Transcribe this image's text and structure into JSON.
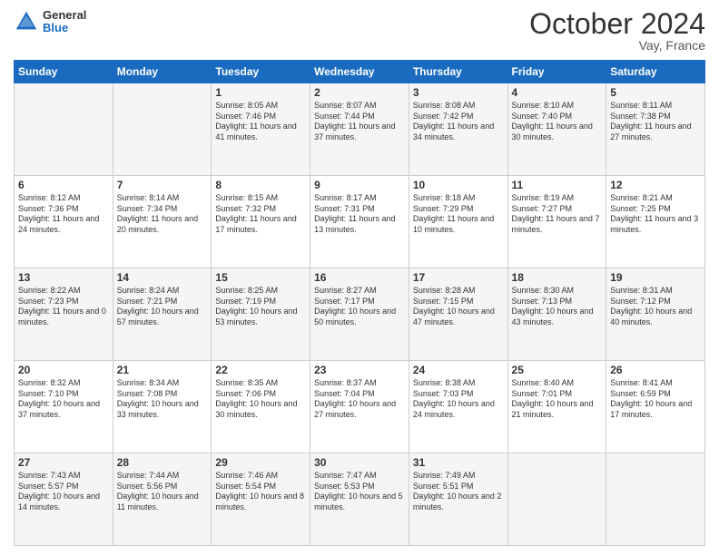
{
  "header": {
    "logo_general": "General",
    "logo_blue": "Blue",
    "month_title": "October 2024",
    "location": "Vay, France"
  },
  "weekdays": [
    "Sunday",
    "Monday",
    "Tuesday",
    "Wednesday",
    "Thursday",
    "Friday",
    "Saturday"
  ],
  "weeks": [
    [
      {
        "day": "",
        "sunrise": "",
        "sunset": "",
        "daylight": ""
      },
      {
        "day": "",
        "sunrise": "",
        "sunset": "",
        "daylight": ""
      },
      {
        "day": "1",
        "sunrise": "Sunrise: 8:05 AM",
        "sunset": "Sunset: 7:46 PM",
        "daylight": "Daylight: 11 hours and 41 minutes."
      },
      {
        "day": "2",
        "sunrise": "Sunrise: 8:07 AM",
        "sunset": "Sunset: 7:44 PM",
        "daylight": "Daylight: 11 hours and 37 minutes."
      },
      {
        "day": "3",
        "sunrise": "Sunrise: 8:08 AM",
        "sunset": "Sunset: 7:42 PM",
        "daylight": "Daylight: 11 hours and 34 minutes."
      },
      {
        "day": "4",
        "sunrise": "Sunrise: 8:10 AM",
        "sunset": "Sunset: 7:40 PM",
        "daylight": "Daylight: 11 hours and 30 minutes."
      },
      {
        "day": "5",
        "sunrise": "Sunrise: 8:11 AM",
        "sunset": "Sunset: 7:38 PM",
        "daylight": "Daylight: 11 hours and 27 minutes."
      }
    ],
    [
      {
        "day": "6",
        "sunrise": "Sunrise: 8:12 AM",
        "sunset": "Sunset: 7:36 PM",
        "daylight": "Daylight: 11 hours and 24 minutes."
      },
      {
        "day": "7",
        "sunrise": "Sunrise: 8:14 AM",
        "sunset": "Sunset: 7:34 PM",
        "daylight": "Daylight: 11 hours and 20 minutes."
      },
      {
        "day": "8",
        "sunrise": "Sunrise: 8:15 AM",
        "sunset": "Sunset: 7:32 PM",
        "daylight": "Daylight: 11 hours and 17 minutes."
      },
      {
        "day": "9",
        "sunrise": "Sunrise: 8:17 AM",
        "sunset": "Sunset: 7:31 PM",
        "daylight": "Daylight: 11 hours and 13 minutes."
      },
      {
        "day": "10",
        "sunrise": "Sunrise: 8:18 AM",
        "sunset": "Sunset: 7:29 PM",
        "daylight": "Daylight: 11 hours and 10 minutes."
      },
      {
        "day": "11",
        "sunrise": "Sunrise: 8:19 AM",
        "sunset": "Sunset: 7:27 PM",
        "daylight": "Daylight: 11 hours and 7 minutes."
      },
      {
        "day": "12",
        "sunrise": "Sunrise: 8:21 AM",
        "sunset": "Sunset: 7:25 PM",
        "daylight": "Daylight: 11 hours and 3 minutes."
      }
    ],
    [
      {
        "day": "13",
        "sunrise": "Sunrise: 8:22 AM",
        "sunset": "Sunset: 7:23 PM",
        "daylight": "Daylight: 11 hours and 0 minutes."
      },
      {
        "day": "14",
        "sunrise": "Sunrise: 8:24 AM",
        "sunset": "Sunset: 7:21 PM",
        "daylight": "Daylight: 10 hours and 57 minutes."
      },
      {
        "day": "15",
        "sunrise": "Sunrise: 8:25 AM",
        "sunset": "Sunset: 7:19 PM",
        "daylight": "Daylight: 10 hours and 53 minutes."
      },
      {
        "day": "16",
        "sunrise": "Sunrise: 8:27 AM",
        "sunset": "Sunset: 7:17 PM",
        "daylight": "Daylight: 10 hours and 50 minutes."
      },
      {
        "day": "17",
        "sunrise": "Sunrise: 8:28 AM",
        "sunset": "Sunset: 7:15 PM",
        "daylight": "Daylight: 10 hours and 47 minutes."
      },
      {
        "day": "18",
        "sunrise": "Sunrise: 8:30 AM",
        "sunset": "Sunset: 7:13 PM",
        "daylight": "Daylight: 10 hours and 43 minutes."
      },
      {
        "day": "19",
        "sunrise": "Sunrise: 8:31 AM",
        "sunset": "Sunset: 7:12 PM",
        "daylight": "Daylight: 10 hours and 40 minutes."
      }
    ],
    [
      {
        "day": "20",
        "sunrise": "Sunrise: 8:32 AM",
        "sunset": "Sunset: 7:10 PM",
        "daylight": "Daylight: 10 hours and 37 minutes."
      },
      {
        "day": "21",
        "sunrise": "Sunrise: 8:34 AM",
        "sunset": "Sunset: 7:08 PM",
        "daylight": "Daylight: 10 hours and 33 minutes."
      },
      {
        "day": "22",
        "sunrise": "Sunrise: 8:35 AM",
        "sunset": "Sunset: 7:06 PM",
        "daylight": "Daylight: 10 hours and 30 minutes."
      },
      {
        "day": "23",
        "sunrise": "Sunrise: 8:37 AM",
        "sunset": "Sunset: 7:04 PM",
        "daylight": "Daylight: 10 hours and 27 minutes."
      },
      {
        "day": "24",
        "sunrise": "Sunrise: 8:38 AM",
        "sunset": "Sunset: 7:03 PM",
        "daylight": "Daylight: 10 hours and 24 minutes."
      },
      {
        "day": "25",
        "sunrise": "Sunrise: 8:40 AM",
        "sunset": "Sunset: 7:01 PM",
        "daylight": "Daylight: 10 hours and 21 minutes."
      },
      {
        "day": "26",
        "sunrise": "Sunrise: 8:41 AM",
        "sunset": "Sunset: 6:59 PM",
        "daylight": "Daylight: 10 hours and 17 minutes."
      }
    ],
    [
      {
        "day": "27",
        "sunrise": "Sunrise: 7:43 AM",
        "sunset": "Sunset: 5:57 PM",
        "daylight": "Daylight: 10 hours and 14 minutes."
      },
      {
        "day": "28",
        "sunrise": "Sunrise: 7:44 AM",
        "sunset": "Sunset: 5:56 PM",
        "daylight": "Daylight: 10 hours and 11 minutes."
      },
      {
        "day": "29",
        "sunrise": "Sunrise: 7:46 AM",
        "sunset": "Sunset: 5:54 PM",
        "daylight": "Daylight: 10 hours and 8 minutes."
      },
      {
        "day": "30",
        "sunrise": "Sunrise: 7:47 AM",
        "sunset": "Sunset: 5:53 PM",
        "daylight": "Daylight: 10 hours and 5 minutes."
      },
      {
        "day": "31",
        "sunrise": "Sunrise: 7:49 AM",
        "sunset": "Sunset: 5:51 PM",
        "daylight": "Daylight: 10 hours and 2 minutes."
      },
      {
        "day": "",
        "sunrise": "",
        "sunset": "",
        "daylight": ""
      },
      {
        "day": "",
        "sunrise": "",
        "sunset": "",
        "daylight": ""
      }
    ]
  ]
}
